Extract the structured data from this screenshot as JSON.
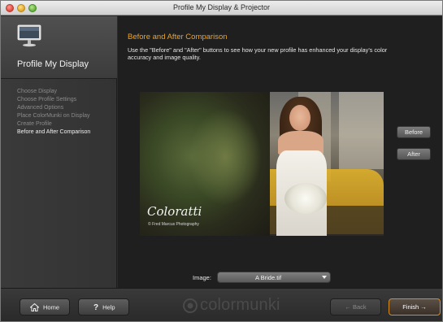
{
  "window": {
    "title": "Profile My Display & Projector"
  },
  "sidebar": {
    "title": "Profile My Display",
    "steps": [
      {
        "label": "Choose Display"
      },
      {
        "label": "Choose Profile Settings"
      },
      {
        "label": "Advanced Options"
      },
      {
        "label": "Place ColorMunki on Display"
      },
      {
        "label": "Create Profile"
      },
      {
        "label": "Before and After Comparison",
        "current": true
      }
    ]
  },
  "main": {
    "heading": "Before and After Comparison",
    "description": "Use the \"Before\" and \"After\" buttons to see how your new profile has enhanced your display's color accuracy and image quality.",
    "photo": {
      "brand": "Coloratti",
      "credit": "© Fred Marcus Photography"
    },
    "before_label": "Before",
    "after_label": "After",
    "image_label": "Image:",
    "image_value": "A Bride.tif"
  },
  "footer": {
    "home_label": "Home",
    "help_label": "Help",
    "logo": "colormunki",
    "back_label": "← Back",
    "finish_label": "Finish →"
  },
  "colors": {
    "accent": "#f2a31b",
    "background": "#1f1f1f",
    "sidebar": "#363636"
  },
  "icons": {
    "sidebar_header": "monitor-icon",
    "home_button": "house-icon",
    "help_button": "question-icon",
    "logo": "colormunki-logo-icon"
  }
}
